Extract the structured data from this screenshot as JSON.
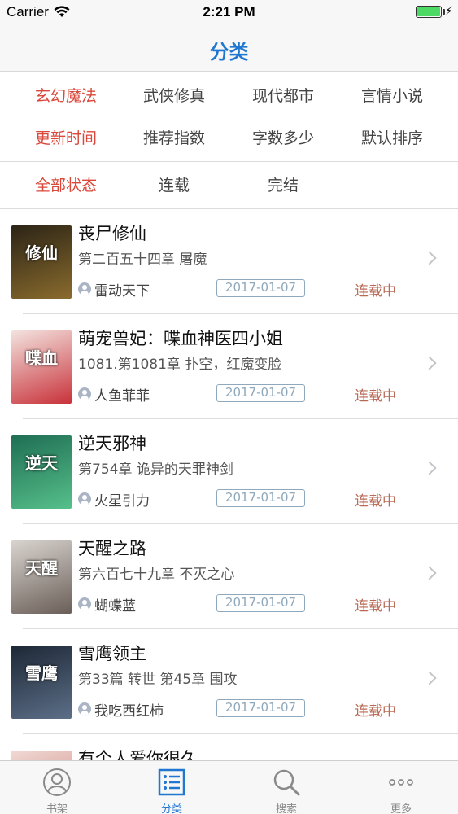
{
  "status_bar": {
    "carrier": "Carrier",
    "time": "2:21 PM",
    "battery_level": 1.0
  },
  "nav": {
    "title": "分类"
  },
  "filters": {
    "genres": [
      {
        "label": "玄幻魔法",
        "active": true
      },
      {
        "label": "武侠修真",
        "active": false
      },
      {
        "label": "现代都市",
        "active": false
      },
      {
        "label": "言情小说",
        "active": false
      }
    ],
    "sorts": [
      {
        "label": "更新时间",
        "active": true
      },
      {
        "label": "推荐指数",
        "active": false
      },
      {
        "label": "字数多少",
        "active": false
      },
      {
        "label": "默认排序",
        "active": false
      }
    ],
    "states": [
      {
        "label": "全部状态",
        "active": true
      },
      {
        "label": "连载",
        "active": false
      },
      {
        "label": "完结",
        "active": false
      }
    ]
  },
  "books": [
    {
      "title": "丧尸修仙",
      "chapter": "第二百五十四章 屠魔",
      "author": "雷动天下",
      "date": "2017-01-07",
      "status": "连载中",
      "cover_colors": [
        "#2b2416",
        "#8a6b2d"
      ],
      "cover_text": "修仙"
    },
    {
      "title": "萌宠兽妃：喋血神医四小姐",
      "chapter": "1081.第1081章 扑空，红魔变脸",
      "author": "人鱼菲菲",
      "date": "2017-01-07",
      "status": "连载中",
      "cover_colors": [
        "#f3e3df",
        "#c8323a"
      ],
      "cover_text": "喋血"
    },
    {
      "title": "逆天邪神",
      "chapter": "第754章 诡异的天罪神剑",
      "author": "火星引力",
      "date": "2017-01-07",
      "status": "连载中",
      "cover_colors": [
        "#1f6e54",
        "#56c08a"
      ],
      "cover_text": "逆天"
    },
    {
      "title": "天醒之路",
      "chapter": "第六百七十九章 不灭之心",
      "author": "蝴蝶蓝",
      "date": "2017-01-07",
      "status": "连载中",
      "cover_colors": [
        "#d9d4cf",
        "#6a5e58"
      ],
      "cover_text": "天醒"
    },
    {
      "title": "雪鹰领主",
      "chapter": "第33篇 转世 第45章 围攻",
      "author": "我吃西红柿",
      "date": "2017-01-07",
      "status": "连载中",
      "cover_colors": [
        "#1d2735",
        "#5c6f88"
      ],
      "cover_text": "雪鹰"
    },
    {
      "title": "有个人爱你很久",
      "chapter": "",
      "author": "",
      "date": "",
      "status": "",
      "cover_colors": [
        "#f1d9d4",
        "#c77a76"
      ],
      "cover_text": ""
    }
  ],
  "tabbar": {
    "tabs": [
      {
        "label": "书架",
        "icon": "person-circle-icon",
        "active": false
      },
      {
        "label": "分类",
        "icon": "list-icon",
        "active": true
      },
      {
        "label": "搜索",
        "icon": "search-icon",
        "active": false
      },
      {
        "label": "更多",
        "icon": "more-dots-icon",
        "active": false
      }
    ]
  },
  "colors": {
    "accent": "#1f77d0",
    "active_filter": "#d9483b",
    "status": "#b96a55",
    "date_border": "#8fa8bb"
  }
}
